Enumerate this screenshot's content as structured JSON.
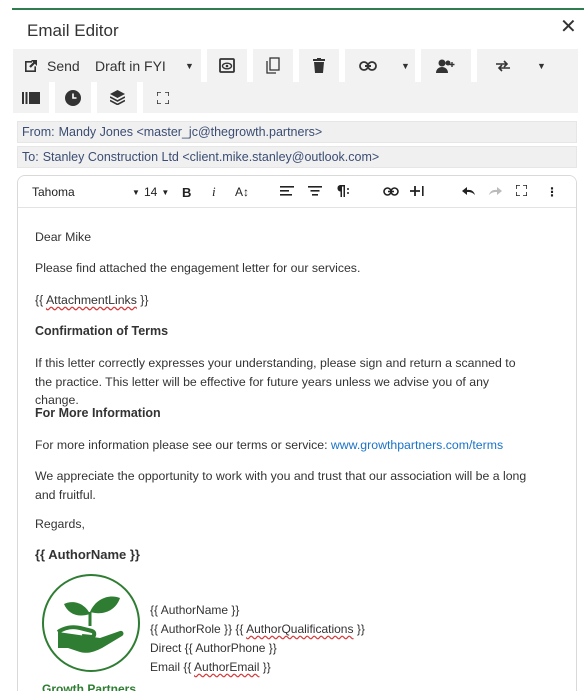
{
  "window": {
    "title": "Email Editor",
    "close_glyph": "✕"
  },
  "toolbar": {
    "send_label": "Send",
    "status_label": "Draft in FYI",
    "icons": [
      "send-icon",
      "preview-icon",
      "copy-icon",
      "delete-icon",
      "link-icon",
      "assign-user-icon",
      "swap-icon",
      "library-icon",
      "clock-icon",
      "layers-icon",
      "fullscreen-icon"
    ]
  },
  "from": {
    "label": "From:",
    "value": "Mandy Jones <master_jc@thegrowth.partners>"
  },
  "to": {
    "label": "To:",
    "value": "Stanley Construction Ltd <client.mike.stanley@outlook.com>"
  },
  "editor_toolbar": {
    "font_family": "Tahoma",
    "font_size": "14",
    "bold_label": "B",
    "italic_label": "i",
    "fontsize_label": "A↕"
  },
  "body": {
    "greeting": "Dear Mike",
    "intro": "Please find attached the engagement letter for our services.",
    "attachment_placeholder_open": "{{ ",
    "attachment_placeholder_name": "AttachmentLinks",
    "attachment_placeholder_close": " }}",
    "heading_terms": "Confirmation of Terms",
    "terms_text": "If this letter correctly expresses your understanding, please sign and return a scanned to the practice. This letter will be effective for future years unless we advise you of any change.",
    "heading_info": "For More Information",
    "info_text": "For more information please see our terms or service: ",
    "info_link": "www.growthpartners.com/terms",
    "appreciation": "We appreciate the opportunity to work with you and trust that our association will be a long and fruitful.",
    "regards": "Regards,",
    "author_name": "{{ AuthorName }}"
  },
  "signature": {
    "logo_text": "Growth Partners",
    "line1": "{{ AuthorName }}",
    "line2_a": "{{ AuthorRole }} {{ ",
    "line2_b": "AuthorQualifications",
    "line2_c": " }}",
    "line3": "Direct {{ AuthorPhone }}",
    "line4_a": "Email {{ ",
    "line4_b": "AuthorEmail",
    "line4_c": " }}"
  },
  "colors": {
    "accent": "#2e7d4f",
    "link": "#1a73c7",
    "logo_green": "#2e7d32",
    "address_text": "#3b4d73"
  }
}
